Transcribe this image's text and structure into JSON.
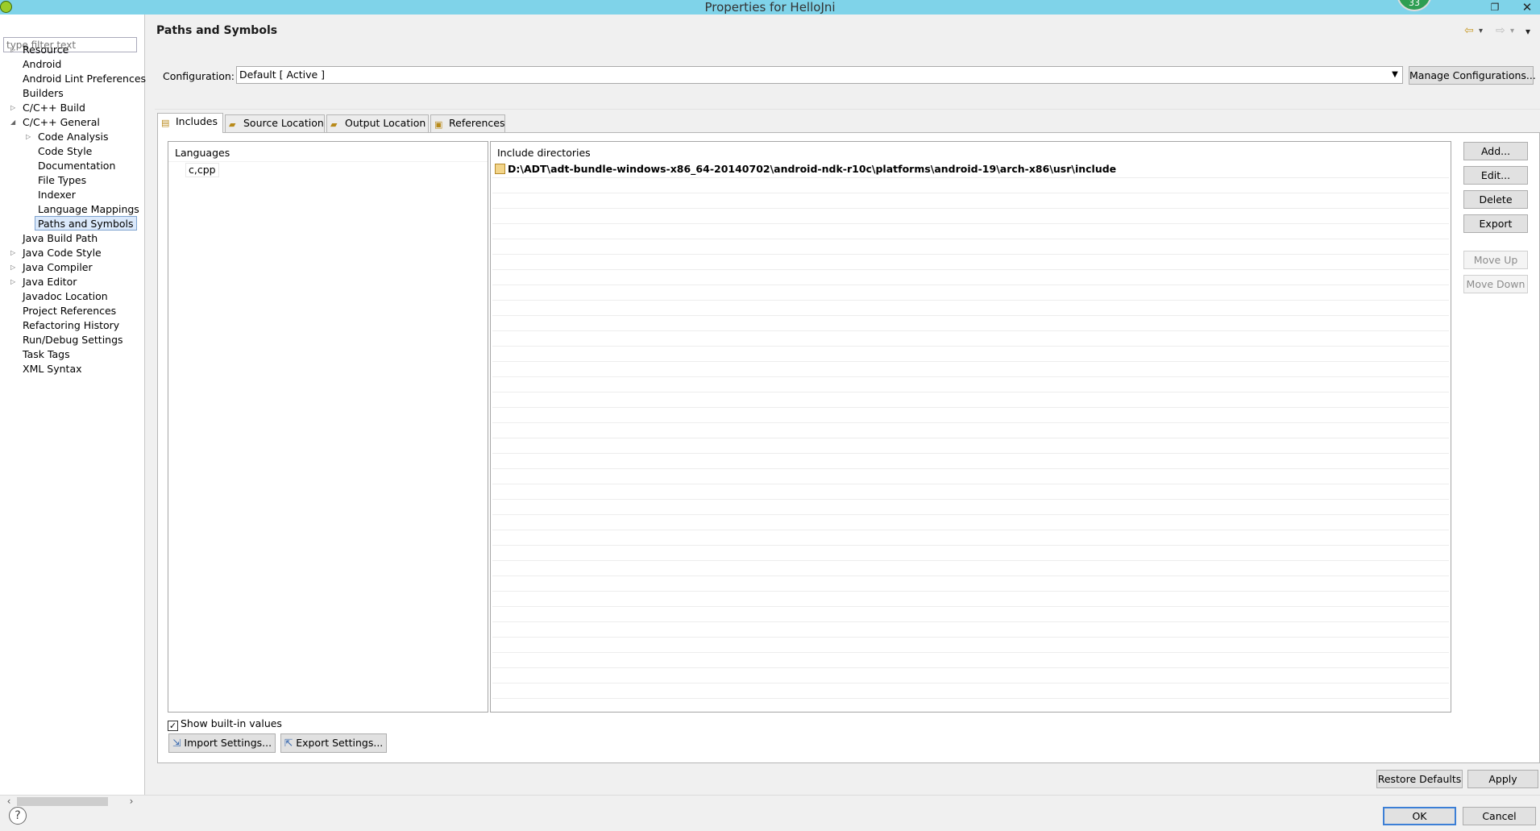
{
  "window": {
    "title": "Properties for HelloJni",
    "notification_count": "33",
    "restore_glyph": "❐",
    "close_glyph": "✕"
  },
  "filter": {
    "placeholder": "type filter text"
  },
  "tree": [
    {
      "label": "Resource",
      "level": 0,
      "expander": "collapsed"
    },
    {
      "label": "Android",
      "level": 0,
      "expander": "none"
    },
    {
      "label": "Android Lint Preferences",
      "level": 0,
      "expander": "none"
    },
    {
      "label": "Builders",
      "level": 0,
      "expander": "none"
    },
    {
      "label": "C/C++ Build",
      "level": 0,
      "expander": "collapsed"
    },
    {
      "label": "C/C++ General",
      "level": 0,
      "expander": "expanded"
    },
    {
      "label": "Code Analysis",
      "level": 1,
      "expander": "collapsed"
    },
    {
      "label": "Code Style",
      "level": 1,
      "expander": "none"
    },
    {
      "label": "Documentation",
      "level": 1,
      "expander": "none"
    },
    {
      "label": "File Types",
      "level": 1,
      "expander": "none"
    },
    {
      "label": "Indexer",
      "level": 1,
      "expander": "none"
    },
    {
      "label": "Language Mappings",
      "level": 1,
      "expander": "none"
    },
    {
      "label": "Paths and Symbols",
      "level": 1,
      "expander": "none",
      "selected": true
    },
    {
      "label": "Java Build Path",
      "level": 0,
      "expander": "none"
    },
    {
      "label": "Java Code Style",
      "level": 0,
      "expander": "collapsed"
    },
    {
      "label": "Java Compiler",
      "level": 0,
      "expander": "collapsed"
    },
    {
      "label": "Java Editor",
      "level": 0,
      "expander": "collapsed"
    },
    {
      "label": "Javadoc Location",
      "level": 0,
      "expander": "none"
    },
    {
      "label": "Project References",
      "level": 0,
      "expander": "none"
    },
    {
      "label": "Refactoring History",
      "level": 0,
      "expander": "none"
    },
    {
      "label": "Run/Debug Settings",
      "level": 0,
      "expander": "none"
    },
    {
      "label": "Task Tags",
      "level": 0,
      "expander": "none"
    },
    {
      "label": "XML Syntax",
      "level": 0,
      "expander": "none"
    }
  ],
  "page": {
    "title": "Paths and Symbols",
    "back_glyph": "⇦",
    "forward_glyph": "⇨",
    "menu_glyph": "▾",
    "configuration_label": "Configuration:",
    "configuration_value": "Default  [ Active ]",
    "manage_configurations": "Manage Configurations...",
    "tabs": [
      {
        "label": "Includes",
        "active": true
      },
      {
        "label": "Source Location",
        "active": false
      },
      {
        "label": "Output Location",
        "active": false
      },
      {
        "label": "References",
        "active": false
      }
    ],
    "languages_header": "Languages",
    "languages": [
      "c,cpp"
    ],
    "include_header": "Include directories",
    "include_dirs": [
      "D:\\ADT\\adt-bundle-windows-x86_64-20140702\\android-ndk-r10c\\platforms\\android-19\\arch-x86\\usr\\include"
    ],
    "side_buttons": {
      "add": "Add...",
      "edit": "Edit...",
      "delete": "Delete",
      "export": "Export",
      "move_up": "Move Up",
      "move_down": "Move Down"
    },
    "show_builtin": {
      "label": "Show built-in values",
      "checked": true
    },
    "import_settings": "Import Settings...",
    "export_settings": "Export Settings...",
    "restore_defaults": "Restore Defaults",
    "apply": "Apply"
  },
  "footer": {
    "help_glyph": "?",
    "ok": "OK",
    "cancel": "Cancel"
  }
}
